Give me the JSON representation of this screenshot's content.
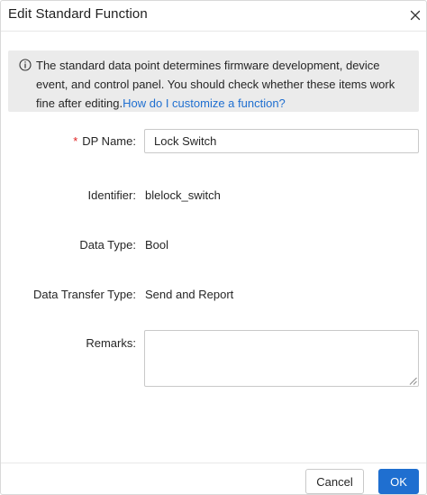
{
  "dialog": {
    "title": "Edit Standard Function",
    "close_icon": "close-icon"
  },
  "notice": {
    "icon": "info-circle-icon",
    "text": "The standard data point determines firmware development, device event, and control panel. You should check whether these items work fine after editing.",
    "link_text": "How do I customize a function?"
  },
  "form": {
    "dp_name": {
      "required_mark": "*",
      "label": "DP Name",
      "value": "Lock Switch"
    },
    "identifier": {
      "label": "Identifier",
      "value": "blelock_switch"
    },
    "data_type": {
      "label": "Data Type",
      "value": "Bool"
    },
    "data_transfer_type": {
      "label": "Data Transfer Type",
      "value": "Send and Report"
    },
    "remarks": {
      "label": "Remarks",
      "value": ""
    },
    "label_suffix": ":"
  },
  "footer": {
    "cancel_label": "Cancel",
    "ok_label": "OK"
  },
  "colors": {
    "accent": "#1f6fd0",
    "required": "#e02020",
    "notice_bg": "#ebebeb"
  }
}
